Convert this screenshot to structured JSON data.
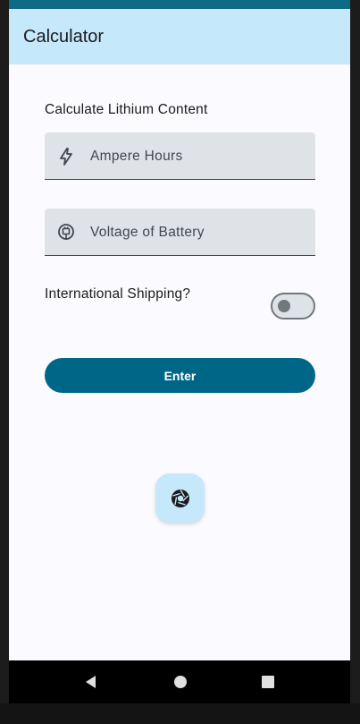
{
  "app_bar": {
    "title": "Calculator"
  },
  "form": {
    "section_label": "Calculate Lithium Content",
    "ampere_field": {
      "placeholder": "Ampere Hours",
      "icon": "bolt-icon"
    },
    "voltage_field": {
      "placeholder": "Voltage of Battery",
      "icon": "power-plug-icon"
    },
    "shipping_switch": {
      "label": "International Shipping?",
      "checked": false
    },
    "enter_label": "Enter"
  },
  "fab": {
    "icon": "camera-shutter-icon"
  },
  "nav": {
    "back_icon": "back-triangle-icon",
    "home_icon": "home-circle-icon",
    "recents_icon": "recents-square-icon"
  },
  "colors": {
    "app_bar_bg": "#c6e8fb",
    "status_bar": "#0f6a86",
    "primary": "#006688",
    "field_bg": "#dfe3e8",
    "screen_bg": "#fbfafe"
  }
}
